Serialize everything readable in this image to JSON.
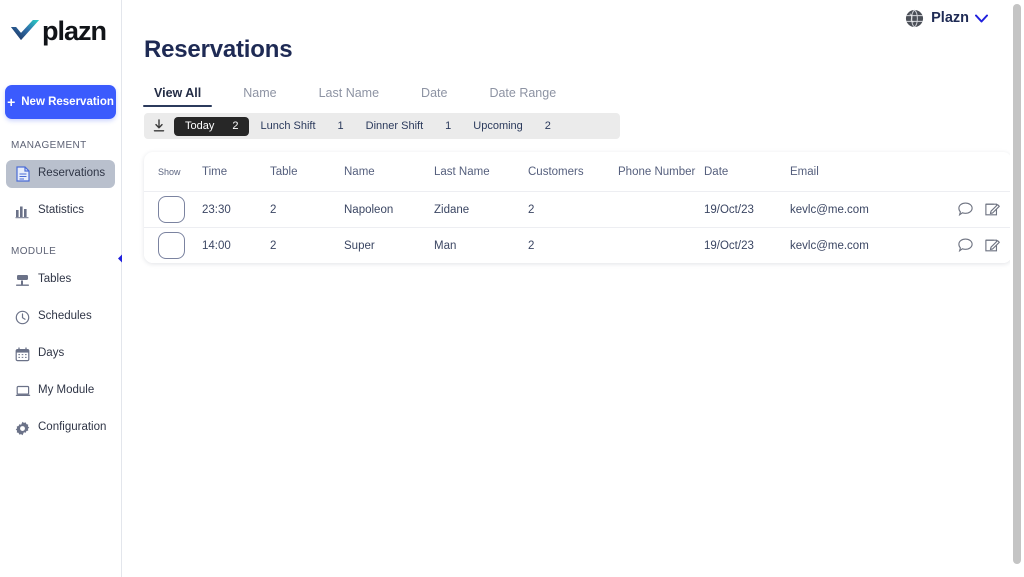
{
  "brand": {
    "logo_text": "plazn",
    "logo_icon": "checkmark-icon"
  },
  "topbar": {
    "globe_icon": "globe-icon",
    "account_name": "Plazn",
    "chevron_icon": "chevron-down-icon"
  },
  "sidebar": {
    "new_reservation_label": "New Reservation",
    "new_reservation_icon": "plus-icon",
    "collapse_icon": "chevron-left-icon",
    "groups": [
      {
        "label": "MANAGEMENT",
        "items": [
          {
            "label": "Reservations",
            "icon": "document-icon",
            "active": true
          },
          {
            "label": "Statistics",
            "icon": "bar-chart-icon",
            "active": false
          }
        ]
      },
      {
        "label": "MODULE",
        "items": [
          {
            "label": "Tables",
            "icon": "table-icon",
            "active": false
          },
          {
            "label": "Schedules",
            "icon": "clock-icon",
            "active": false
          },
          {
            "label": "Days",
            "icon": "calendar-icon",
            "active": false
          },
          {
            "label": "My Module",
            "icon": "laptop-icon",
            "active": false
          },
          {
            "label": "Configuration",
            "icon": "gear-icon",
            "active": false
          }
        ]
      }
    ]
  },
  "page": {
    "title": "Reservations"
  },
  "tabs": [
    {
      "label": "View All",
      "active": true
    },
    {
      "label": "Name",
      "active": false
    },
    {
      "label": "Last Name",
      "active": false
    },
    {
      "label": "Date",
      "active": false
    },
    {
      "label": "Date Range",
      "active": false
    }
  ],
  "filterbar": {
    "download_icon": "download-icon",
    "chips": [
      {
        "label": "Today",
        "count": "2",
        "active": true
      },
      {
        "label": "Lunch Shift",
        "count": "1",
        "active": false
      },
      {
        "label": "Dinner Shift",
        "count": "1",
        "active": false
      },
      {
        "label": "Upcoming",
        "count": "2",
        "active": false
      }
    ]
  },
  "table": {
    "headers": {
      "show": "Show",
      "time": "Time",
      "table": "Table",
      "name": "Name",
      "last_name": "Last Name",
      "customers": "Customers",
      "phone_number": "Phone Number",
      "date": "Date",
      "email": "Email"
    },
    "row_actions": {
      "comment_icon": "comment-icon",
      "edit_icon": "edit-icon",
      "delete_icon": "trash-icon"
    },
    "rows": [
      {
        "checked": false,
        "time": "23:30",
        "table": "2",
        "name": "Napoleon",
        "last_name": "Zidane",
        "customers": "2",
        "phone_number": "",
        "date": "19/Oct/23",
        "email": "kevlc@me.com"
      },
      {
        "checked": false,
        "time": "14:00",
        "table": "2",
        "name": "Super",
        "last_name": "Man",
        "customers": "2",
        "phone_number": "",
        "date": "19/Oct/23",
        "email": "kevlc@me.com"
      }
    ]
  },
  "colors": {
    "accent_blue": "#3b5bfd",
    "navy": "#1e2a54",
    "text": "#3b4663",
    "active_nav_bg": "#b9c0cd",
    "filter_bar_bg": "#ebebeb",
    "active_chip_bg": "#272727"
  }
}
